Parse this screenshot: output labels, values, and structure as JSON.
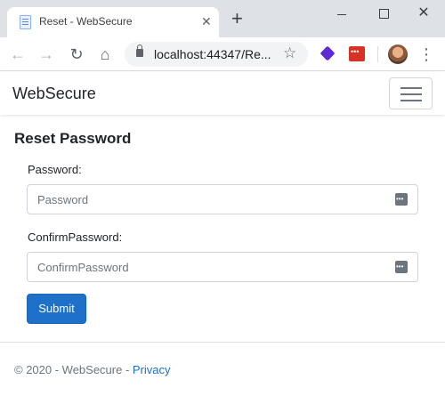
{
  "browser": {
    "tab_title": "Reset - WebSecure",
    "tab_close": "✕",
    "new_tab": "+",
    "url": "localhost:44347/Re...",
    "window_close": "✕"
  },
  "navbar": {
    "brand": "WebSecure"
  },
  "form": {
    "title": "Reset Password",
    "password_label": "Password:",
    "password_placeholder": "Password",
    "confirm_label": "ConfirmPassword:",
    "confirm_placeholder": "ConfirmPassword",
    "submit_label": "Submit"
  },
  "footer": {
    "copyright": "© 2020 - WebSecure - ",
    "privacy_link": "Privacy"
  },
  "colors": {
    "accent": "#1e70c9",
    "text": "#212529",
    "muted": "#6c757d"
  }
}
